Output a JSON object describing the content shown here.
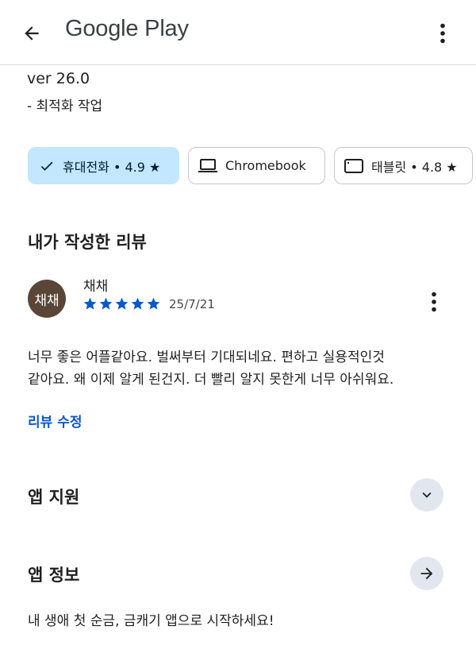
{
  "header": {
    "title": "Google Play",
    "back_icon": "arrow-back-icon",
    "more_icon": "more-vert-icon"
  },
  "whats_new": {
    "version": "ver 26.0",
    "note": "- 최적화 작업"
  },
  "device_chips": [
    {
      "label": "휴대전화 • 4.9 ★",
      "icon": "check-icon",
      "selected": true
    },
    {
      "label": "Chromebook",
      "icon": "laptop-icon",
      "selected": false
    },
    {
      "label": "태블릿 • 4.8 ★",
      "icon": "tablet-icon",
      "selected": false
    }
  ],
  "my_review": {
    "section_title": "내가 작성한 리뷰",
    "avatar_text": "채채",
    "reviewer_name": "채채",
    "rating": 5,
    "date": "25/7/21",
    "text_line1": "너무 좋은 어플같아요. 벌써부터 기대되네요. 편하고 실용적인것",
    "text_line2": "같아요. 왜 이제 알게 된건지. 더 빨리 알지 못한게 너무 아쉬워요.",
    "edit_label": "리뷰 수정"
  },
  "app_support": {
    "title": "앱 지원",
    "icon": "chevron-down-icon"
  },
  "app_info": {
    "title": "앱 정보",
    "icon": "arrow-forward-icon",
    "tagline": "내 생애 첫 순금, 금캐기 앱으로 시작하세요!"
  },
  "colors": {
    "selected_chip_bg": "#c2e7ff",
    "star_blue": "#0b57d0",
    "link_blue": "#0b57d0",
    "avatar_bg": "#5a4637",
    "round_button_bg": "#e2e6ee"
  }
}
